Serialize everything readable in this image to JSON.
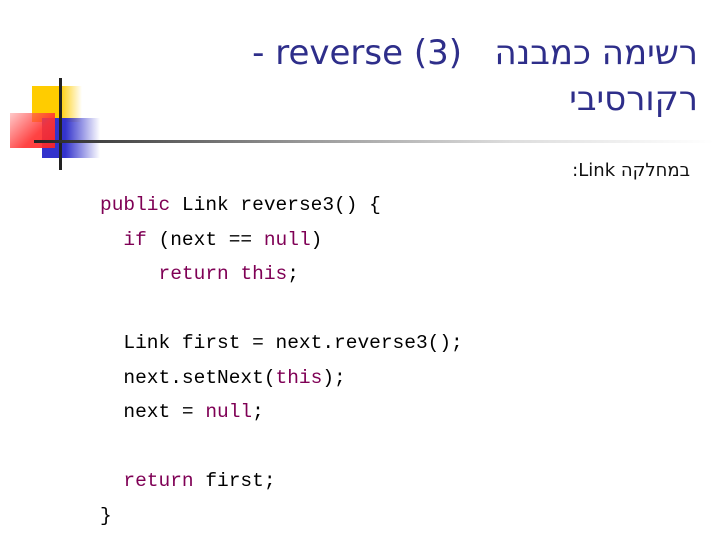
{
  "slide": {
    "title": {
      "hebrew_prefix": "רשימה כמבנה",
      "spacer": "   ",
      "dash": "- ",
      "latin": "reverse (3)",
      "second_line": "רקורסיבי"
    },
    "subtitle": "במחלקה Link:",
    "colors": {
      "title": "#2e2e8a",
      "keyword": "#7f0055",
      "code": "#000000",
      "deco_yellow": "#ffcc00",
      "deco_blue": "#3333cc",
      "deco_red": "#ff3333"
    },
    "code": {
      "lines": [
        [
          {
            "t": "public",
            "k": true
          },
          {
            "t": " Link reverse3() {",
            "k": false
          }
        ],
        [
          {
            "t": "  ",
            "k": false
          },
          {
            "t": "if",
            "k": true
          },
          {
            "t": " (next == ",
            "k": false
          },
          {
            "t": "null",
            "k": true
          },
          {
            "t": ")",
            "k": false
          }
        ],
        [
          {
            "t": "     ",
            "k": false
          },
          {
            "t": "return",
            "k": true
          },
          {
            "t": " ",
            "k": false
          },
          {
            "t": "this",
            "k": true
          },
          {
            "t": ";",
            "k": false
          }
        ],
        [
          {
            "t": "",
            "k": false
          }
        ],
        [
          {
            "t": "  Link first = next.reverse3();",
            "k": false
          }
        ],
        [
          {
            "t": "  next.setNext(",
            "k": false
          },
          {
            "t": "this",
            "k": true
          },
          {
            "t": ");",
            "k": false
          }
        ],
        [
          {
            "t": "  next = ",
            "k": false
          },
          {
            "t": "null",
            "k": true
          },
          {
            "t": ";",
            "k": false
          }
        ],
        [
          {
            "t": "",
            "k": false
          }
        ],
        [
          {
            "t": "  ",
            "k": false
          },
          {
            "t": "return",
            "k": true
          },
          {
            "t": " first;",
            "k": false
          }
        ],
        [
          {
            "t": "}",
            "k": false
          }
        ]
      ]
    }
  }
}
